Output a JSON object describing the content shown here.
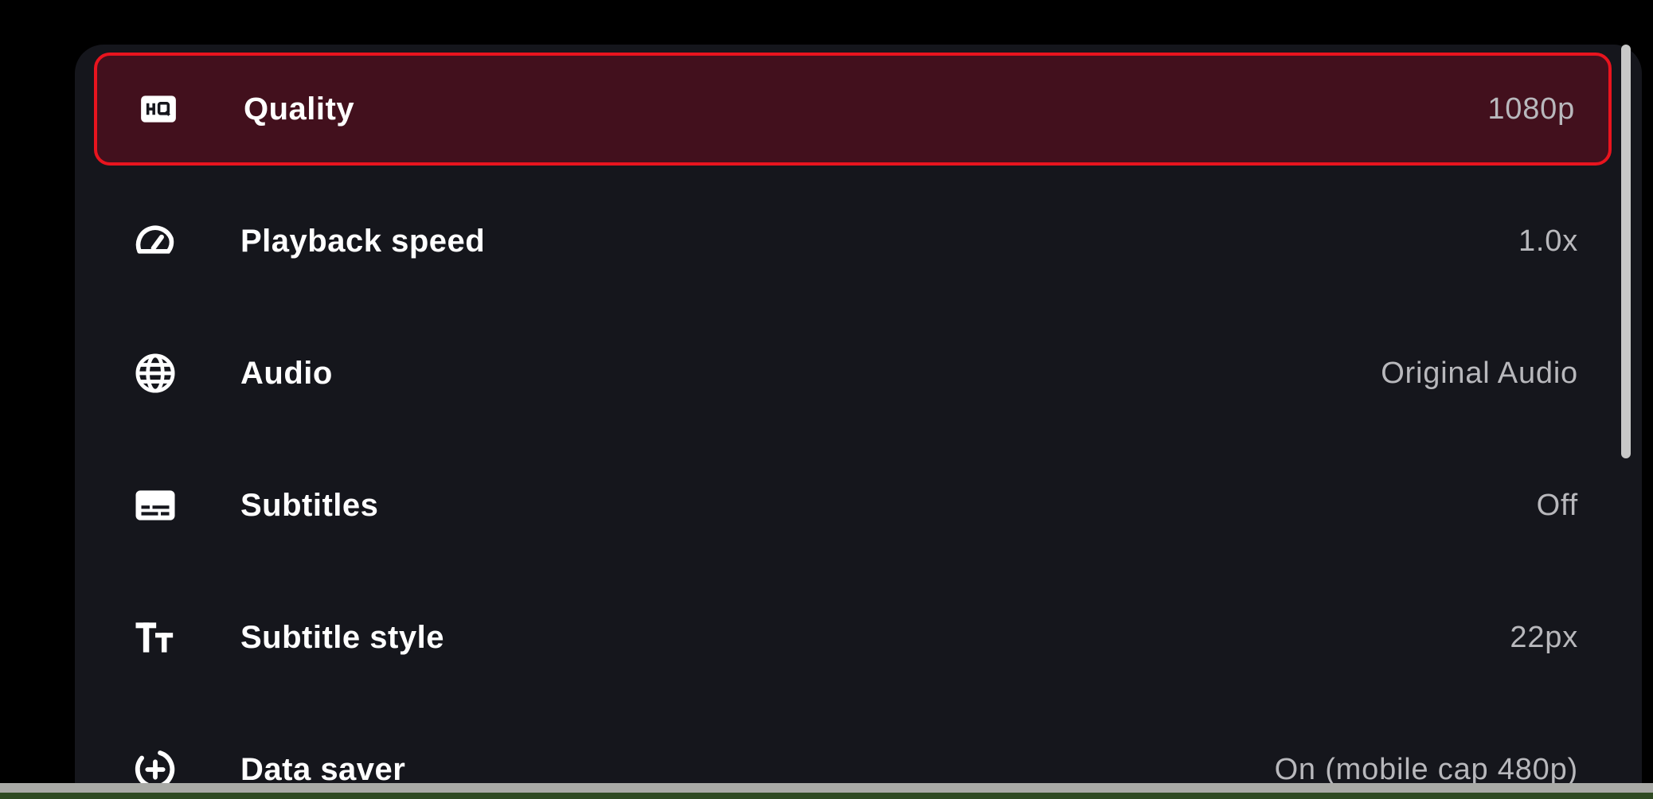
{
  "settings_menu": {
    "items": [
      {
        "icon": "hq-icon",
        "label": "Quality",
        "value": "1080p",
        "selected": true
      },
      {
        "icon": "speedometer-icon",
        "label": "Playback speed",
        "value": "1.0x",
        "selected": false
      },
      {
        "icon": "globe-icon",
        "label": "Audio",
        "value": "Original Audio",
        "selected": false
      },
      {
        "icon": "subtitles-icon",
        "label": "Subtitles",
        "value": "Off",
        "selected": false
      },
      {
        "icon": "text-size-icon",
        "label": "Subtitle style",
        "value": "22px",
        "selected": false
      },
      {
        "icon": "data-saver-icon",
        "label": "Data saver",
        "value": "On (mobile cap 480p)",
        "selected": false
      }
    ]
  },
  "colors": {
    "background": "#000000",
    "panel": "#15161c",
    "selected_fill": "#42101d",
    "selected_border": "#e8141e",
    "label": "#ffffff",
    "value": "#b8b8bc"
  }
}
